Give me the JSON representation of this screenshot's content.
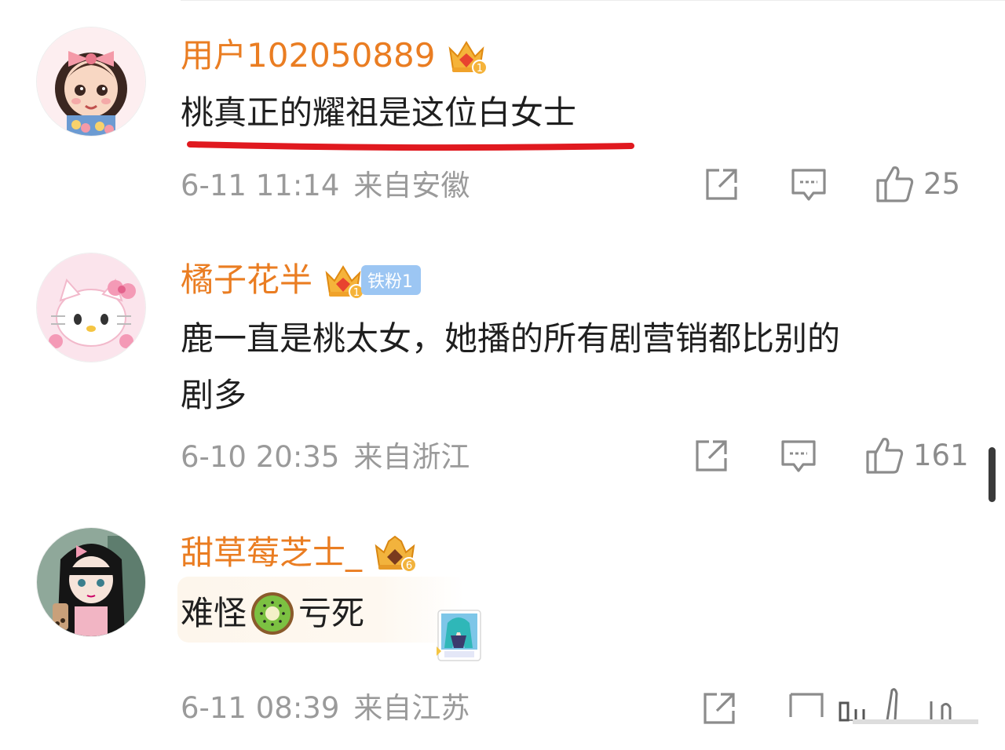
{
  "comments": [
    {
      "username": "用户102050889",
      "crown_level": "1",
      "text_lines": [
        "桃真正的耀祖是这位白女士"
      ],
      "date": "6-11 11:14",
      "location": "来自安徽",
      "likes": "25",
      "underlined": true
    },
    {
      "username": "橘子花半",
      "crown_level": "1",
      "fan_badge": "铁粉1",
      "text_lines": [
        "鹿一直是桃太女，她播的所有剧营销都比别的",
        "剧多"
      ],
      "date": "6-10 20:35",
      "location": "来自浙江",
      "likes": "161"
    },
    {
      "username": "甜草莓芝士_",
      "crown_level": "6",
      "text_before_emoji": "难怪",
      "emoji": "kiwi-emoji",
      "text_after_emoji": "亏死",
      "date": "6-11 08:39",
      "location": "来自江苏",
      "sticker": "miku-sticker"
    }
  ],
  "icons": {
    "share": "share-icon",
    "comment": "comment-icon",
    "like": "thumbs-up-icon"
  },
  "colors": {
    "username": "#ea7d22",
    "underline": "#e0191f",
    "meta": "#9a9a9a",
    "fan_badge": "#9cc6f3"
  }
}
